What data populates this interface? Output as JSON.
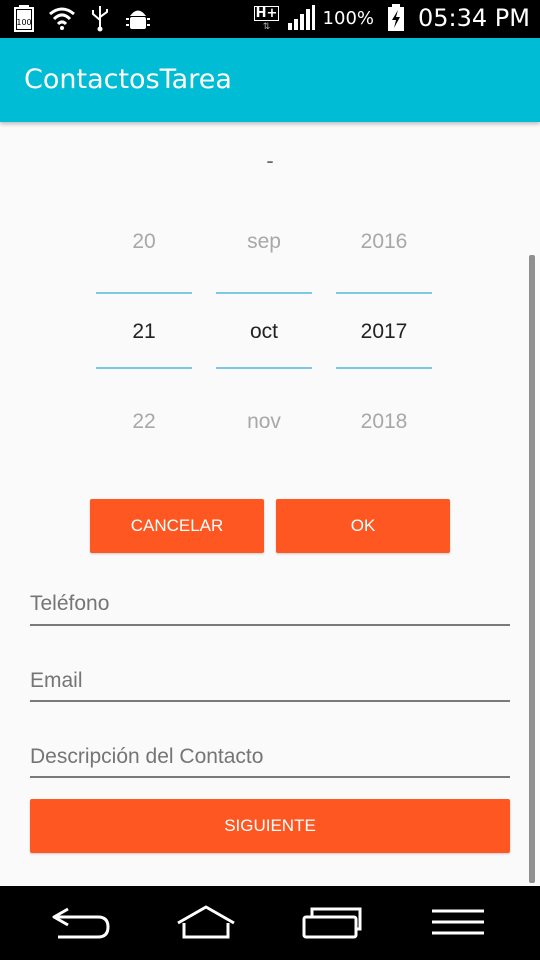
{
  "status_bar": {
    "battery_small": "100",
    "network": "H+",
    "battery_percent": "100%",
    "time": "05:34 PM"
  },
  "app_bar": {
    "title": "ContactosTarea"
  },
  "date_picker": {
    "separator": "-",
    "day": {
      "prev": "20",
      "selected": "21",
      "next": "22"
    },
    "month": {
      "prev": "sep",
      "selected": "oct",
      "next": "nov"
    },
    "year": {
      "prev": "2016",
      "selected": "2017",
      "next": "2018"
    },
    "cancel_label": "CANCELAR",
    "ok_label": "OK"
  },
  "form": {
    "phone_placeholder": "Teléfono",
    "email_placeholder": "Email",
    "description_placeholder": "Descripción del Contacto",
    "next_label": "SIGUIENTE"
  },
  "colors": {
    "app_bar": "#00BCD4",
    "accent_button": "#FF5722",
    "picker_divider": "#7EC8E3"
  },
  "icons": [
    "battery-icon",
    "wifi-icon",
    "usb-icon",
    "android-debug-icon",
    "network-hplus-icon",
    "signal-icon",
    "charging-battery-icon",
    "back-icon",
    "home-icon",
    "recent-apps-icon",
    "menu-icon"
  ]
}
